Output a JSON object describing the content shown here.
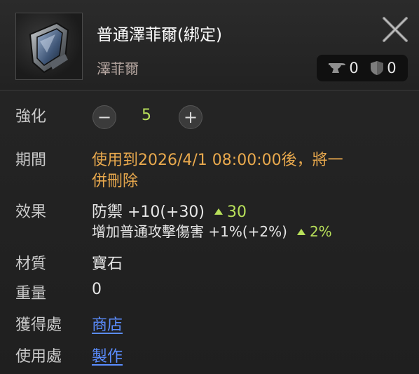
{
  "item": {
    "name": "普通澤菲爾(綁定)",
    "type": "澤菲爾",
    "anvil_count": "0",
    "shield_count": "0"
  },
  "rows": {
    "enhance": {
      "label": "強化",
      "value": "5"
    },
    "period": {
      "label": "期間",
      "line1": "使用到2026/4/1 08:00:00後，將一",
      "line2": "併刪除"
    },
    "effect": {
      "label": "效果",
      "line1_text": "防禦  +10(+30)",
      "line1_delta": "30",
      "line2_text": "增加普通攻擊傷害 +1%(+2%)",
      "line2_delta": "2%"
    },
    "material": {
      "label": "材質",
      "value": "寶石"
    },
    "weight": {
      "label": "重量",
      "value": "0"
    },
    "obtain": {
      "label": "獲得處",
      "value": "商店"
    },
    "use": {
      "label": "使用處",
      "value": "製作"
    }
  },
  "colors": {
    "accent_orange": "#e9a94d",
    "link_blue": "#5b8dff",
    "delta_green": "#b8e05a",
    "enhance_green": "#b8e05a"
  },
  "icons": [
    "close-icon",
    "anvil-icon",
    "shield-icon",
    "minus-icon",
    "plus-icon",
    "increase-triangle-icon"
  ]
}
